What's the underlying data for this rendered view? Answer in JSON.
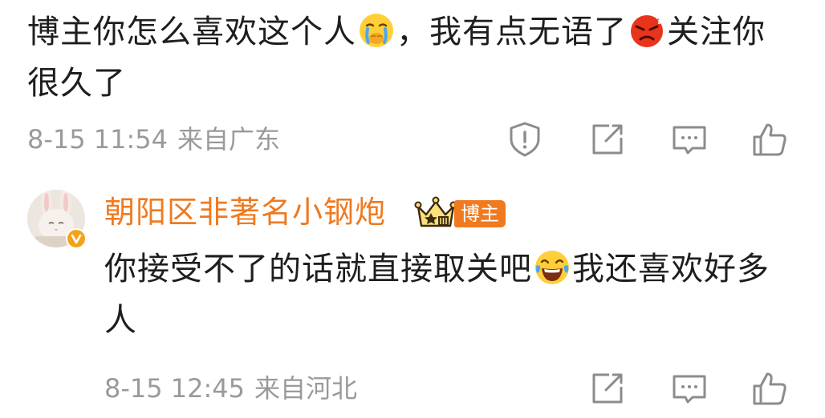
{
  "comment": {
    "text_part1": "博主你怎么喜欢这个人",
    "emoji1": "crying-face-emoji",
    "text_part2": "，我有点无语了",
    "emoji2": "angry-face-emoji",
    "text_part3": "关注你很久了",
    "date": "8-15 11:54",
    "location": "来自广东"
  },
  "reply": {
    "author_name": "朝阳区非著名小钢炮",
    "author_badge": "博主",
    "text_part1": "你接受不了的话就直接取关吧",
    "emoji": "laughing-tears-emoji",
    "text_part2": "我还喜欢好多人",
    "date": "8-15 12:45",
    "location": "来自河北"
  },
  "colors": {
    "name_orange": "#ef7a1f",
    "text": "#1e1e1e",
    "meta_gray": "#9a9a9a",
    "icon_gray": "#8c8c8c"
  },
  "icons": {
    "report": "report-icon",
    "repost": "repost-icon",
    "comment": "comment-icon",
    "like": "like-icon"
  }
}
